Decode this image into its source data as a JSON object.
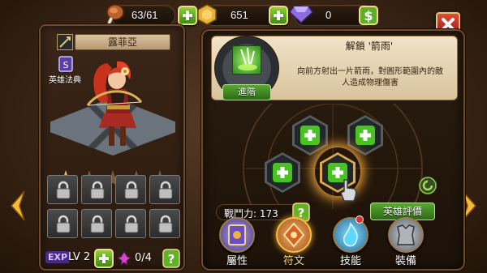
{
  "resources": {
    "stamina": "63/61",
    "gold": "651",
    "gems": "0"
  },
  "hero": {
    "name": "露菲亞",
    "book_label": "英雄法典",
    "stars_total": 5,
    "stars_filled": 1,
    "level": "LV 2",
    "exp_label": "EXP",
    "shards": "0/4"
  },
  "skill": {
    "title": "解鎖 '箭雨'",
    "description": "向前方射出一片箭雨，對圓形範圍內的敵人造成物理傷害",
    "advance_label": "進階"
  },
  "stats": {
    "power": "戰鬥力: 173",
    "rate_button": "英雄評價"
  },
  "nav": {
    "attributes": "屬性",
    "runes": "符文",
    "skills": "技能",
    "equipment": "裝備"
  },
  "colors": {
    "accent_gold": "#f1c04a",
    "button_green": "#4bc223",
    "close_red": "#c22f24"
  }
}
